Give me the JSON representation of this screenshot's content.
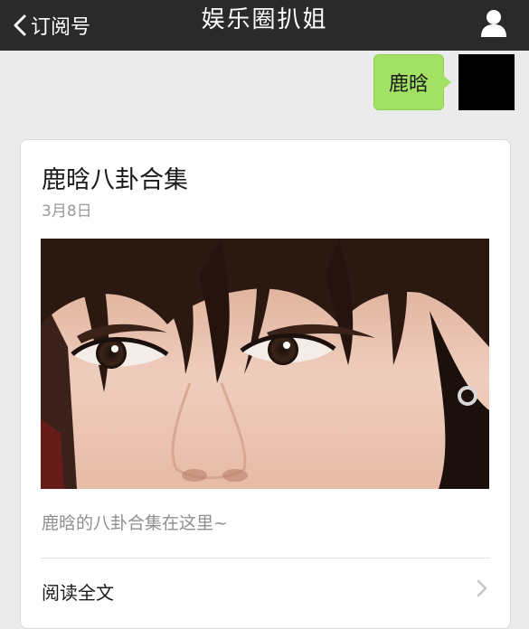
{
  "nav": {
    "back_label": "订阅号",
    "title": "娱乐圈扒姐",
    "back_icon": "chevron-left-icon",
    "profile_icon": "person-icon"
  },
  "chat": {
    "message_text": "鹿晗",
    "bubble_color": "#a3e164"
  },
  "article": {
    "title": "鹿晗八卦合集",
    "date": "3月8日",
    "description": "鹿晗的八卦合集在这里~",
    "read_more": "阅读全文",
    "chevron_icon": "chevron-right-icon"
  },
  "colors": {
    "nav_bg": "#2a2a2a",
    "page_bg": "#ebebeb",
    "card_bg": "#ffffff"
  }
}
